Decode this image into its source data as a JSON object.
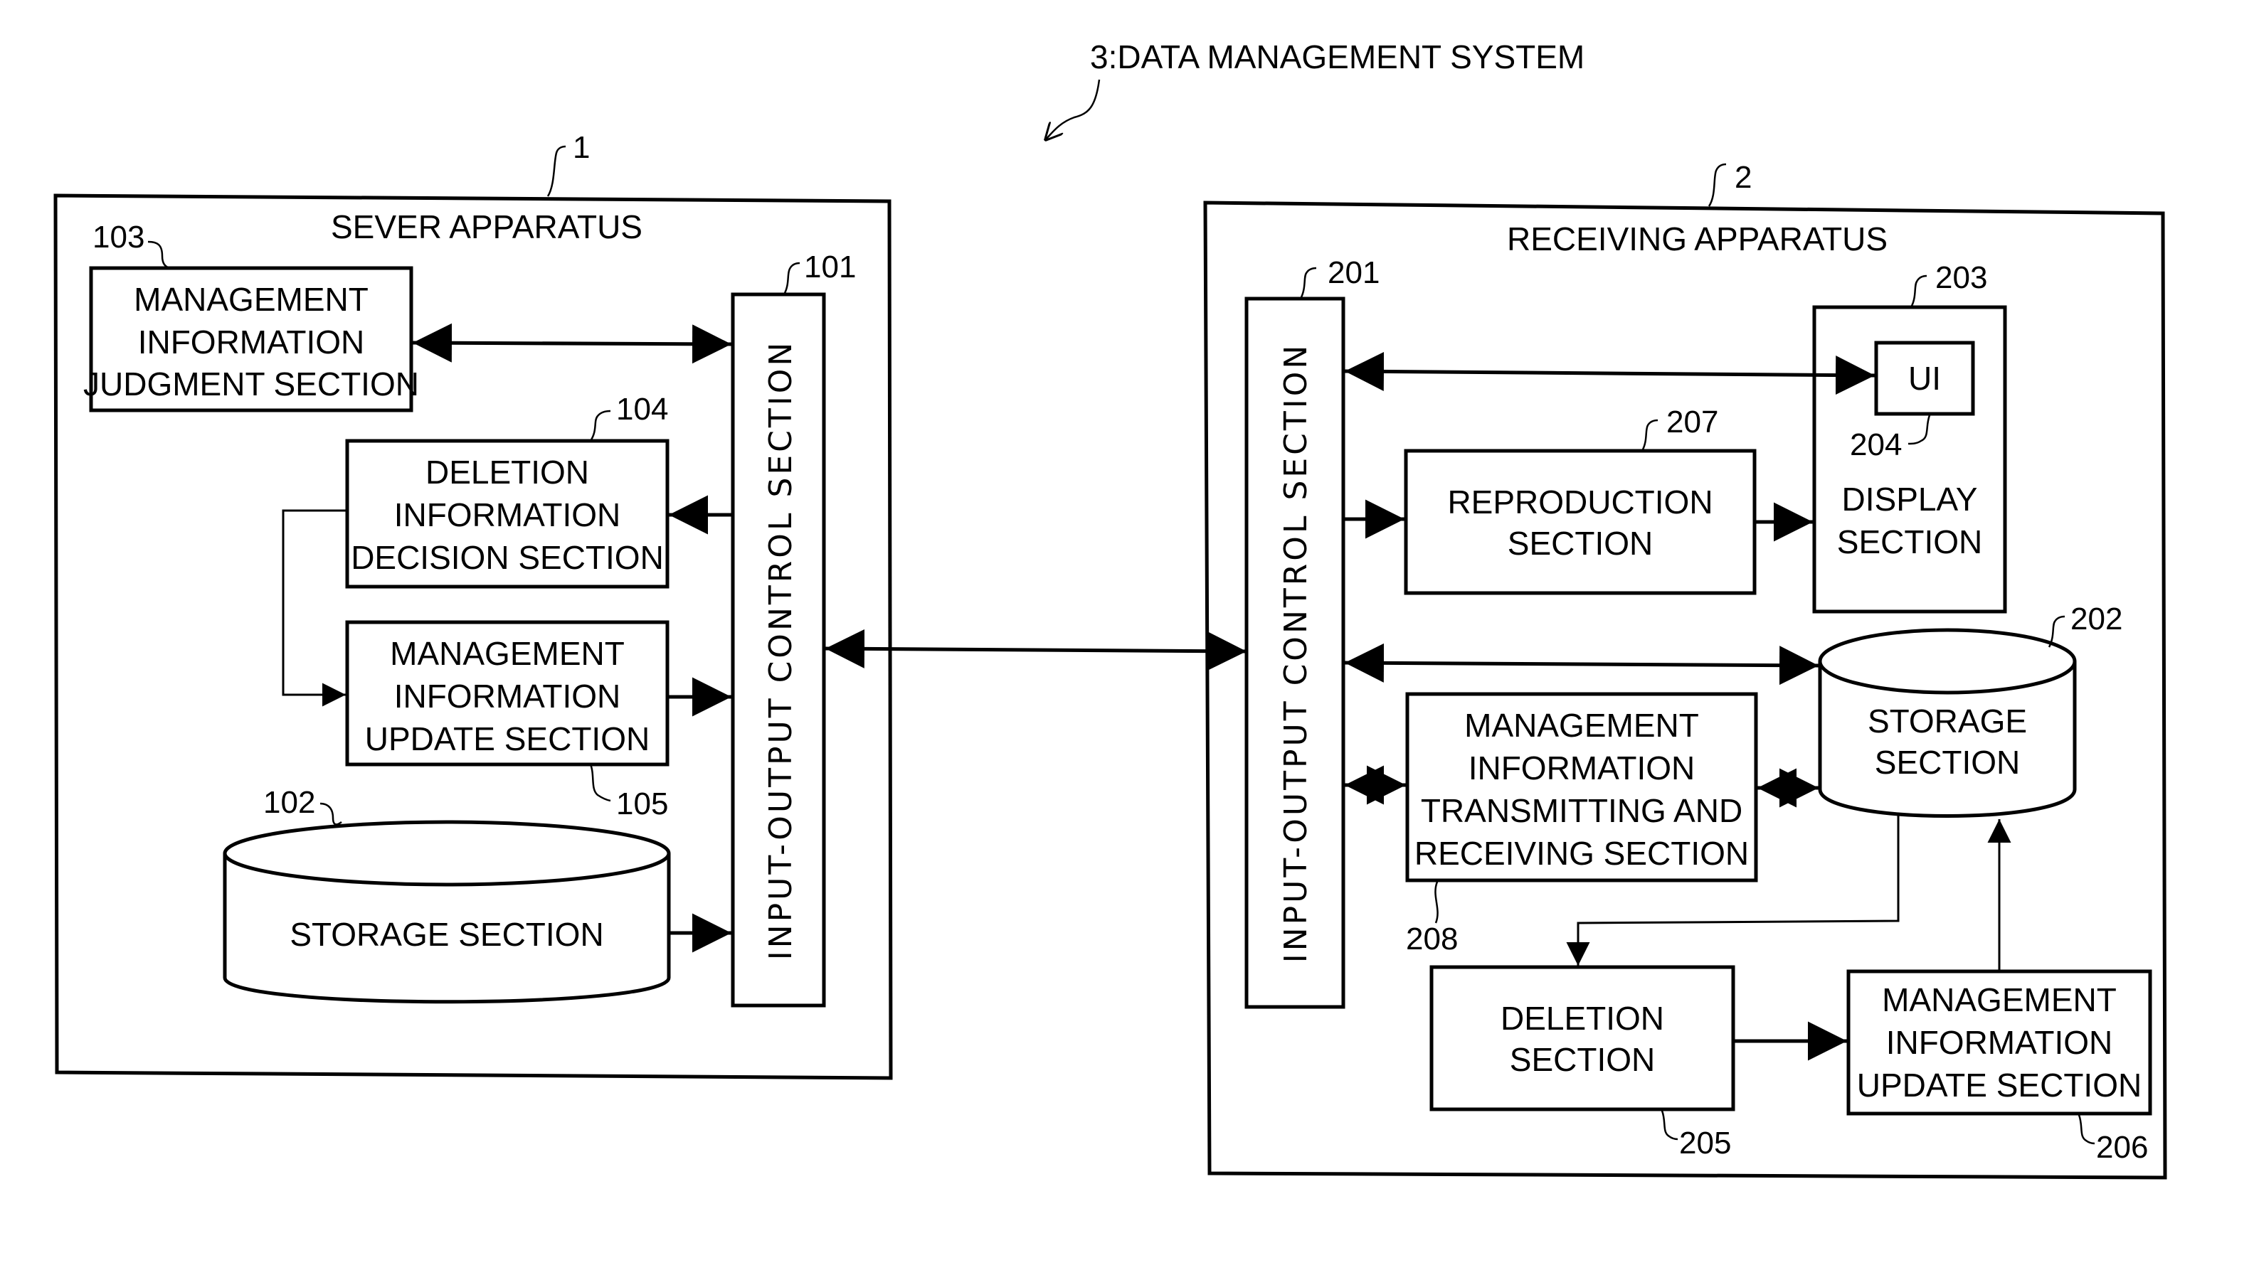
{
  "system": {
    "title": "3:DATA MANAGEMENT SYSTEM"
  },
  "server": {
    "ref": "1",
    "title": "SEVER APPARATUS",
    "io_control": {
      "ref": "101",
      "label": "INPUT-OUTPUT CONTROL SECTION"
    },
    "storage": {
      "ref": "102",
      "label": "STORAGE SECTION"
    },
    "judgment": {
      "ref": "103",
      "lines": [
        "MANAGEMENT",
        "INFORMATION",
        "JUDGMENT SECTION"
      ]
    },
    "deletion_decision": {
      "ref": "104",
      "lines": [
        "DELETION",
        "INFORMATION",
        "DECISION SECTION"
      ]
    },
    "update": {
      "ref": "105",
      "lines": [
        "MANAGEMENT",
        "INFORMATION",
        "UPDATE SECTION"
      ]
    }
  },
  "receiver": {
    "ref": "2",
    "title": "RECEIVING APPARATUS",
    "io_control": {
      "ref": "201",
      "label": "INPUT-OUTPUT CONTROL SECTION"
    },
    "storage": {
      "ref": "202",
      "lines": [
        "STORAGE",
        "SECTION"
      ]
    },
    "display": {
      "ref": "203",
      "lines": [
        "DISPLAY",
        "SECTION"
      ]
    },
    "ui": {
      "ref": "204",
      "label": "UI"
    },
    "deletion": {
      "ref": "205",
      "lines": [
        "DELETION",
        "SECTION"
      ]
    },
    "update": {
      "ref": "206",
      "lines": [
        "MANAGEMENT",
        "INFORMATION",
        "UPDATE SECTION"
      ]
    },
    "reproduction": {
      "ref": "207",
      "lines": [
        "REPRODUCTION",
        "SECTION"
      ]
    },
    "transceiver": {
      "ref": "208",
      "lines": [
        "MANAGEMENT",
        "INFORMATION",
        "TRANSMITTING AND",
        "RECEIVING SECTION"
      ]
    }
  }
}
